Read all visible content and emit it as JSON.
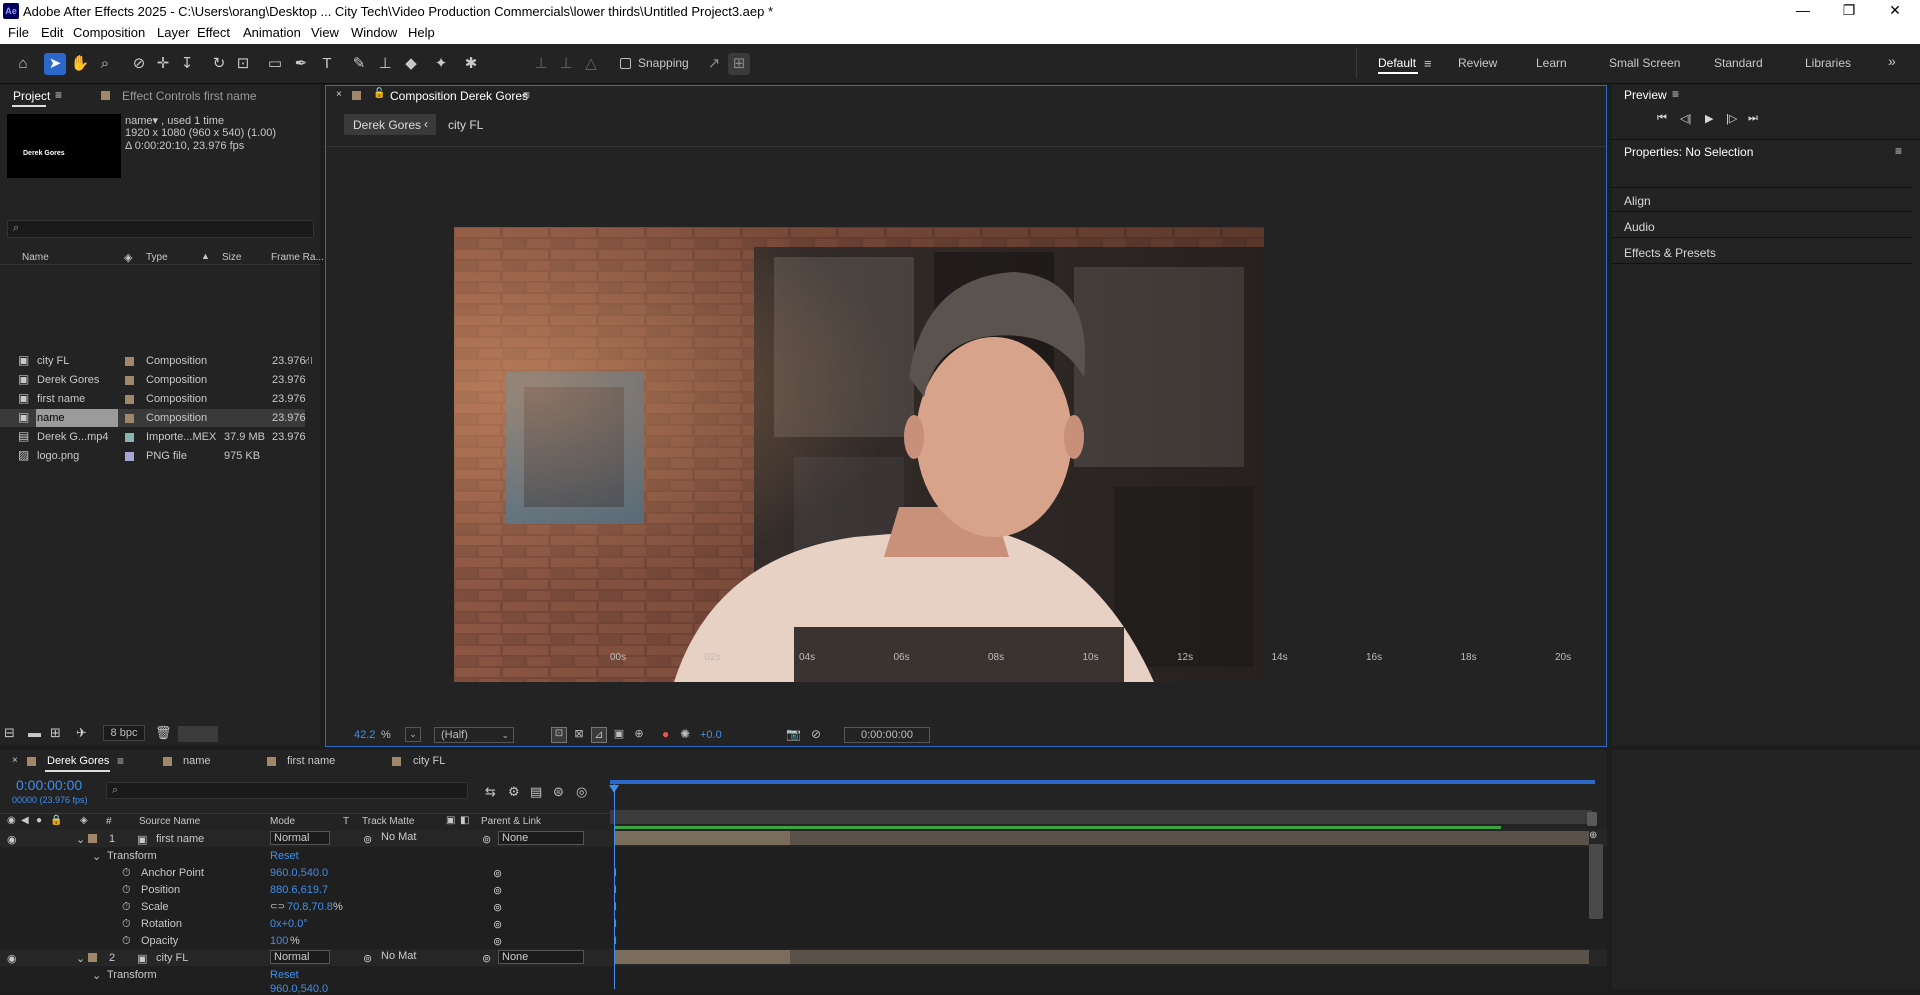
{
  "window": {
    "title": "Adobe After Effects 2025 - C:\\Users\\orang\\Desktop ... City Tech\\Video Production Commercials\\lower thirds\\Untitled Project3.aep *",
    "app_badge": "Ae"
  },
  "menu": [
    "File",
    "Edit",
    "Composition",
    "Layer",
    "Effect",
    "Animation",
    "View",
    "Window",
    "Help"
  ],
  "toolbar": {
    "snapping_label": "Snapping",
    "workspaces": [
      "Default",
      "Review",
      "Learn",
      "Small Screen",
      "Standard",
      "Libraries"
    ],
    "active_workspace": "Default",
    "more": "»"
  },
  "project_panel": {
    "tab_project": "Project",
    "tab_effect_controls": "Effect Controls first name",
    "thumb_text": "Derek Gores",
    "info_name": "name▾ , used 1 time",
    "info_size": "1920 x 1080  (960 x 540) (1.00)",
    "info_duration": "Δ 0:00:20:10, 23.976 fps",
    "search_placeholder": "",
    "columns": [
      "Name",
      "Type",
      "Size",
      "Frame Ra..."
    ],
    "items": [
      {
        "name": "city FL",
        "type": "Composition",
        "size": "",
        "fps": "23.976",
        "kind": "comp",
        "label_color": "#a0876a"
      },
      {
        "name": "Derek Gores",
        "type": "Composition",
        "size": "",
        "fps": "23.976",
        "kind": "comp",
        "label_color": "#a0876a"
      },
      {
        "name": "first name",
        "type": "Composition",
        "size": "",
        "fps": "23.976",
        "kind": "comp",
        "label_color": "#a0876a"
      },
      {
        "name": "name",
        "type": "Composition",
        "size": "",
        "fps": "23.976",
        "kind": "comp",
        "label_color": "#a0876a",
        "selected": true
      },
      {
        "name": "Derek G...mp4",
        "type": "Importe...MEX",
        "size": "37.9 MB",
        "fps": "23.976",
        "kind": "footage",
        "label_color": "#8ab4b4"
      },
      {
        "name": "logo.png",
        "type": "PNG file",
        "size": "975 KB",
        "fps": "",
        "kind": "image",
        "label_color": "#a6a6d4"
      }
    ],
    "bpc": "8 bpc"
  },
  "composition_panel": {
    "tab_label": "Composition Derek Gores",
    "breadcrumb": [
      "Derek Gores",
      "city FL"
    ],
    "zoom_value": "42.2",
    "zoom_unit": "%",
    "resolution": "(Half)",
    "exposure": "+0.0",
    "timecode": "0:00:00:00"
  },
  "right_panel": {
    "preview_title": "Preview",
    "properties_title": "Properties: No Selection",
    "sections": [
      "Align",
      "Audio",
      "Effects & Presets"
    ]
  },
  "timeline": {
    "tabs": [
      {
        "label": "Derek Gores",
        "active": true
      },
      {
        "label": "name"
      },
      {
        "label": "first name"
      },
      {
        "label": "city FL"
      }
    ],
    "timecode": "0:00:00:00",
    "frames_fps": "00000 (23.976 fps)",
    "headers": {
      "num": "#",
      "source": "Source Name",
      "mode": "Mode",
      "t": "T",
      "track_matte": "Track Matte",
      "parent": "Parent & Link"
    },
    "ruler": [
      "00s",
      "02s",
      "04s",
      "06s",
      "08s",
      "10s",
      "12s",
      "14s",
      "16s",
      "18s",
      "20s"
    ],
    "layers": [
      {
        "num": "1",
        "name": "first name",
        "mode": "Normal",
        "matte": "No Mat",
        "parent": "None",
        "transform_label": "Transform",
        "reset": "Reset",
        "props": [
          {
            "name": "Anchor Point",
            "value": "960.0,540.0"
          },
          {
            "name": "Position",
            "value": "880.6,619.7"
          },
          {
            "name": "Scale",
            "value": "70.8,70.8",
            "unit": "%"
          },
          {
            "name": "Rotation",
            "value": "0x+0.0°"
          },
          {
            "name": "Opacity",
            "value": "100",
            "unit": "%"
          }
        ]
      },
      {
        "num": "2",
        "name": "city FL",
        "mode": "Normal",
        "matte": "No Mat",
        "parent": "None",
        "transform_label": "Transform",
        "reset": "Reset",
        "next_value": "960.0,540.0"
      }
    ],
    "layer_bar_end_fraction": 0.18,
    "work_area_end_fraction": 0.91
  },
  "colors": {
    "accent": "#2b68c9",
    "timecode": "#3d8ef0",
    "work_area": "#3fa33f",
    "layer_bar": "#6a5f50"
  }
}
